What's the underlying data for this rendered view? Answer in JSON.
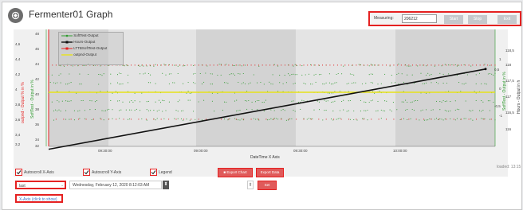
{
  "window": {
    "title": "Fermenter01 Graph"
  },
  "measuring": {
    "label": "Measuring:",
    "value": "206212",
    "start": "Start",
    "stop": "Stop",
    "exit": "Exit"
  },
  "chart_data": {
    "type": "line",
    "xlabel": "DateTime X Axis",
    "x_ticks": [
      "09:30:00",
      "09:00:00",
      "09:30:00",
      "10:00:00"
    ],
    "left_axis_1": {
      "label": "outpnd - Output % in %",
      "ticks": [
        "4,6",
        "4,4",
        "4,2",
        "4",
        "3,8",
        "3,6",
        "3,4",
        "3,2"
      ]
    },
    "left_axis_2": {
      "label": "SoftTest - Output in %",
      "ticks": [
        "48",
        "46",
        "44",
        "42",
        "40",
        "38",
        "36",
        "34",
        "32"
      ]
    },
    "right_axis_1": {
      "label": "SoftTest - Output in %",
      "ticks": [
        "1",
        "0,5",
        "0",
        "-0,5",
        "-1"
      ]
    },
    "right_axis_2": {
      "label": "Hours - Output in h",
      "ticks": [
        "118,5",
        "118",
        "117,5",
        "117",
        "116,5",
        "116"
      ]
    },
    "series": [
      {
        "name": "SoftTest-Output",
        "color": "#2e9a2e"
      },
      {
        "name": "Hours-Output",
        "color": "#111111"
      },
      {
        "name": "LTTBSoftTest-Output",
        "color": "#e52121"
      },
      {
        "name": "outpnd-Output",
        "color": "#e7e21a"
      }
    ],
    "hours_line": {
      "start": 116.2,
      "end": 118.6
    },
    "outpnd_level": 4.0,
    "softtest_range": [
      -1,
      1
    ]
  },
  "controls": {
    "autoscroll_x": "Autoscroll X-Axis",
    "autoscroll_y": "Autoscroll Y-Axis",
    "legend": "Legend",
    "export_chart": "Export Chart",
    "export_data": "Export Data",
    "select_value": "last",
    "date_value": "Wednesday, February 12, 2020 8:12:03 AM",
    "set": "Set",
    "x_axis_link": "X-Axis  (click to show)",
    "loaded": "loaded: 13:15"
  }
}
